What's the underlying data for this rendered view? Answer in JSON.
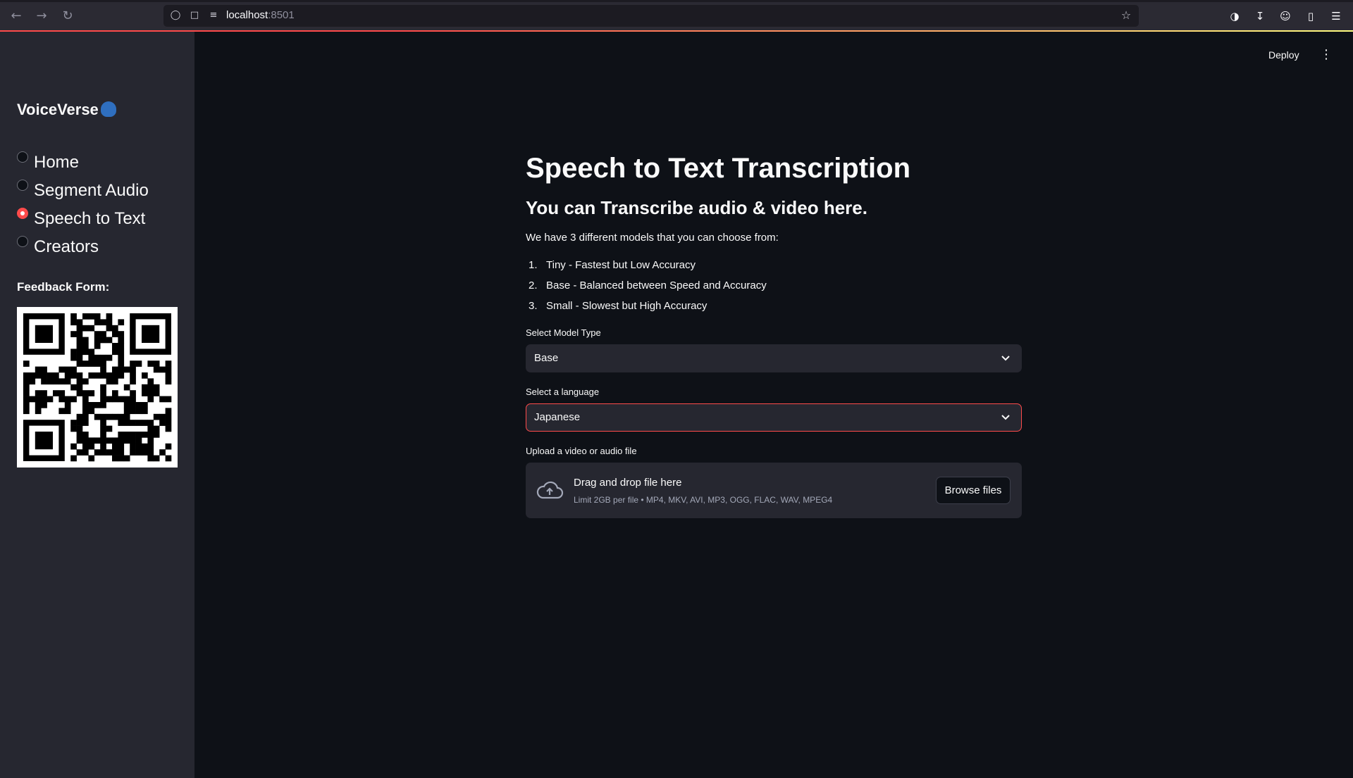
{
  "browser": {
    "url_host": "localhost",
    "url_port": ":8501"
  },
  "sidebar": {
    "brand": "VoiceVerse",
    "nav": [
      {
        "label": "Home",
        "selected": false
      },
      {
        "label": "Segment Audio",
        "selected": false
      },
      {
        "label": "Speech to Text",
        "selected": true
      },
      {
        "label": "Creators",
        "selected": false
      }
    ],
    "feedback_label": "Feedback Form:"
  },
  "header": {
    "deploy_label": "Deploy"
  },
  "main": {
    "title": "Speech to Text Transcription",
    "subtitle": "You can Transcribe audio & video here.",
    "intro": "We have 3 different models that you can choose from:",
    "models": [
      {
        "num": "1.",
        "text": "Tiny - Fastest but Low Accuracy"
      },
      {
        "num": "2.",
        "text": "Base - Balanced between Speed and Accuracy"
      },
      {
        "num": "3.",
        "text": "Small - Slowest but High Accuracy"
      }
    ],
    "model_select": {
      "label": "Select Model Type",
      "value": "Base"
    },
    "language_select": {
      "label": "Select a language",
      "value": "Japanese"
    },
    "uploader": {
      "label": "Upload a video or audio file",
      "title": "Drag and drop file here",
      "limit": "Limit 2GB per file • MP4, MKV, AVI, MP3, OGG, FLAC, WAV, MPEG4",
      "button": "Browse files"
    }
  },
  "colors": {
    "accent": "#ff4b4b",
    "sidebar_bg": "#262730",
    "main_bg": "#0e1117"
  }
}
